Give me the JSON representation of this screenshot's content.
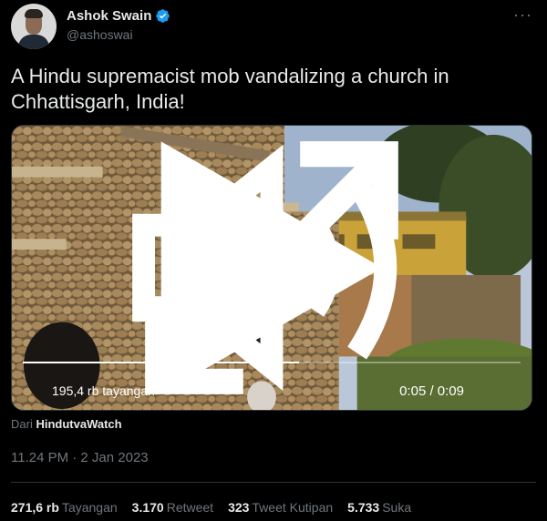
{
  "author": {
    "display_name": "Ashok Swain",
    "handle": "@ashoswai",
    "verified": true,
    "verified_color": "#1d9bf0"
  },
  "more_icon": "more-horizontal-icon",
  "tweet_text": "A Hindu supremacist mob vandalizing a church in Chhattisgarh, India!",
  "video": {
    "views": "195,4 rb tayangan",
    "time": "0:05 / 0:09",
    "progress": 0.555,
    "icons": [
      "play-icon",
      "volume-icon",
      "fullscreen-icon"
    ]
  },
  "source": {
    "prefix": "Dari",
    "account": "HindutvaWatch"
  },
  "timestamp": "11.24 PM · 2 Jan 2023",
  "stats": [
    {
      "num": "271,6 rb",
      "label": "Tayangan"
    },
    {
      "num": "3.170",
      "label": "Retweet"
    },
    {
      "num": "323",
      "label": "Tweet Kutipan"
    },
    {
      "num": "5.733",
      "label": "Suka"
    }
  ],
  "colors": {
    "background": "#000000",
    "text": "#e7e9ea",
    "secondary_text": "#71767b",
    "border": "#2f3336"
  }
}
